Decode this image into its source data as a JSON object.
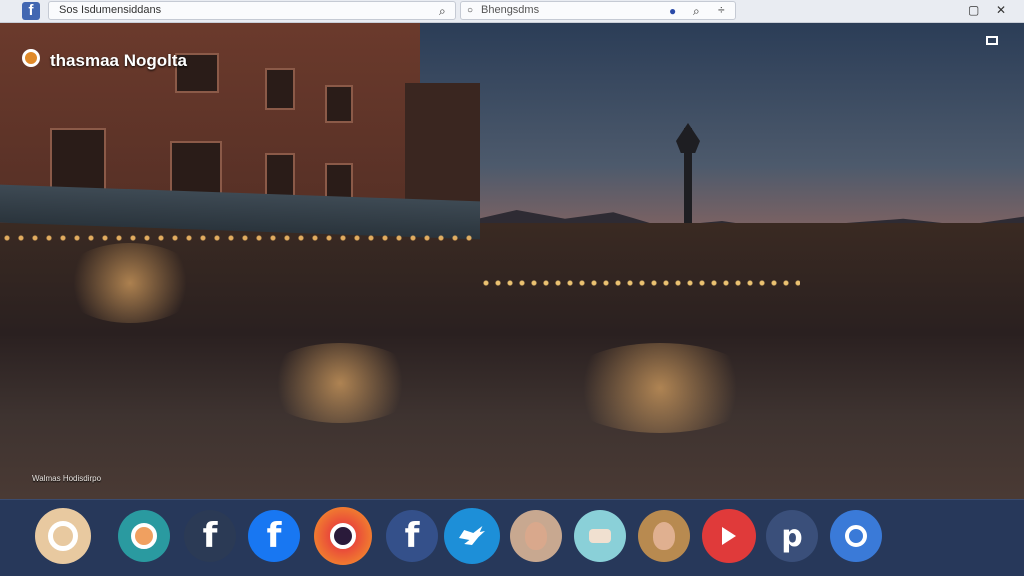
{
  "topbar": {
    "brand": "f",
    "tab1_text": "Sos Isdumensiddans",
    "tab2_text": "Bhengsdms"
  },
  "scene": {
    "title": "thasmaa Nogolta",
    "caption": "Walmas Hodisdirpo"
  },
  "dock": {
    "apps": [
      {
        "name": "camera-app",
        "color": "#e8c9a0"
      },
      {
        "name": "teal-app",
        "color": "#2a9aa0"
      },
      {
        "name": "facebook-dark",
        "color": "#2b3a55",
        "letter": "f"
      },
      {
        "name": "facebook-blue",
        "color": "#1877f2",
        "letter": "f"
      },
      {
        "name": "instagram",
        "color": "#e94a3a"
      },
      {
        "name": "facebook-navy",
        "color": "#34508a",
        "letter": "f"
      },
      {
        "name": "twitter",
        "color": "#1da1f2"
      },
      {
        "name": "profile-1",
        "color": "#c8a890"
      },
      {
        "name": "photo-app",
        "color": "#5ab0c0"
      },
      {
        "name": "profile-2",
        "color": "#b88a50"
      },
      {
        "name": "video-app",
        "color": "#e03a3a"
      },
      {
        "name": "p-app",
        "color": "#3a4f7a",
        "letter": "p"
      },
      {
        "name": "circle-app",
        "color": "#3a7ad8"
      }
    ]
  }
}
